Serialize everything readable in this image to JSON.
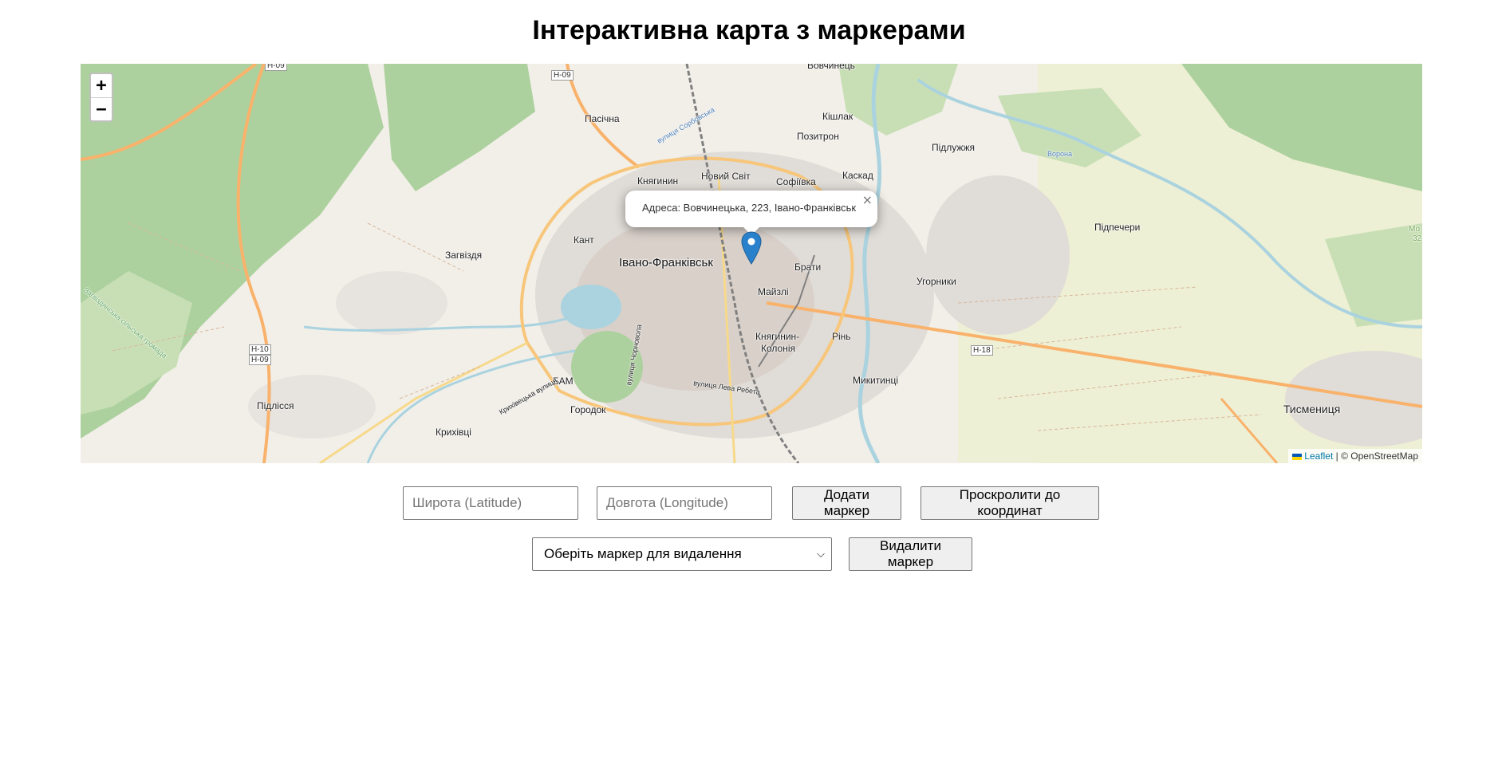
{
  "page": {
    "title": "Інтерактивна карта з маркерами"
  },
  "map": {
    "popup_text": "Адреса: Вовчинецька, 223, Івано-Франківськ",
    "close_glyph": "×",
    "zoom_in": "+",
    "zoom_out": "−",
    "attribution_leaflet": "Leaflet",
    "attribution_rest": " | © OpenStreetMap",
    "marker_color": "#2a81cb",
    "places": {
      "vovchynets": "Вовчинець",
      "h09_top": "Н-09",
      "h09_top2": "Н-09",
      "pasichna": "Пасічна",
      "kishlak": "Кішлак",
      "pozytron": "Позитрон",
      "pidluzhzhia": "Підлужжя",
      "kniahynyn": "Княгинин",
      "novyi_svit": "Новий Світ",
      "sofiivka": "Софіївка",
      "kaskad": "Каскад",
      "pidpechery": "Підпечери",
      "kant": "Кант",
      "zagvizdia": "Загвіздя",
      "ivano_frankivsk": "Івано-Франківськ",
      "braty": "Брати",
      "maizli": "Майзлі",
      "uhornyky": "Угорники",
      "h10": "Н-10",
      "h09_left": "Н-09",
      "kniahynyn_kolonia_1": "Княгинин-",
      "kniahynyn_kolonia_2": "Колонія",
      "rin": "Рінь",
      "h18": "Н-18",
      "bam": "БАМ",
      "mykytyntsi": "Микитинці",
      "pidlissia": "Підлісся",
      "horodok": "Городок",
      "tysmenytsia": "Тисмениця",
      "kryhivtsi": "Крихівці",
      "street_chornovola": "вулиця Чорновола",
      "street_levko": "вулиця Лева Ребета",
      "street_kryhivetska": "Крихівецька вулиця",
      "street_sofiivka": "вулиця Сорбовська",
      "hromada": "Загвіздянська сільська громада",
      "vorona": "Ворона",
      "mo": "Мо",
      "mo32": "32"
    }
  },
  "form": {
    "lat_placeholder": "Широта (Latitude)",
    "lng_placeholder": "Довгота (Longitude)",
    "add_button": "Додати маркер",
    "scroll_button": "Проскролити до координат",
    "select_value": "Оберіть маркер для видалення",
    "delete_button": "Видалити маркер"
  }
}
